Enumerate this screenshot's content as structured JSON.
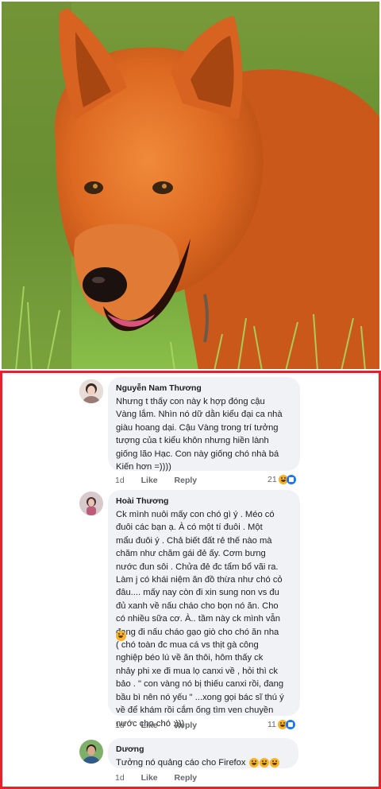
{
  "comments": [
    {
      "name": "Nguyễn Nam Thương",
      "text": "Nhưng t thấy con này k hợp đóng cậu\nVàng lắm. Nhìn nó dữ dằn kiểu đại ca nhà\ngiàu hoang dại. Cậu Vàng trong trí tưởng\ntượng của t kiểu khôn nhưng hiền lành\ngiống lão Hạc. Con này giống chó nhà bá\nKiến hơn =))))",
      "age": "1d",
      "like_label": "Like",
      "reply_label": "Reply",
      "react_count": "21"
    },
    {
      "name": "Hoài Thương",
      "text": "Ck mình nuôi mấy con chó gì ý . Méo có\nđuôi các bạn ạ. À có một tí đuôi . Một\nmẩu đuôi ý . Chả biết đất rẻ thế nào mà\nchăm như chăm gái đẻ ấy. Cơm bưng\nnước đun sôi . Chửa đẻ đc tẩm bổ vãi ra.\nLàm j có khái niệm ăn đồ thừa như chó cỏ\nđâu.... mấy nay còn đi xin sung non vs đu\nđủ xanh về nấu cháo cho bọn nó ăn. Cho\ncó nhiều sữa cơ. À.. tầm này ck mình vẫn\nđang đi nấu cháo gạo giò cho chó ăn nha\n   ( chó toàn đc mua cá vs thịt gà công\nnghiệp béo lú về ăn thôi, hôm thấy ck\nnhảy phi xe đi mua lọ canxi về , hỏi thì ck\nbảo . \" con vàng nó bị thiếu canxi rồi, đang\nbầu bì nên nó yếu \" ...xong gọi bác sĩ thú ý\nvề để khám rồi cắm ống tìm ven chuyền\nnước cho chó :)))",
      "age": "1d",
      "like_label": "Like",
      "reply_label": "Reply",
      "react_count": "11"
    },
    {
      "name": "Dương",
      "text": "Tưởng nó quảng cáo cho Firefox",
      "age": "1d",
      "like_label": "Like",
      "reply_label": "Reply",
      "react_count": ""
    }
  ],
  "colors": {
    "frame_border": "#e8202a",
    "bubble_bg": "#f0f2f5",
    "meta_text": "#65676b"
  },
  "icons": [
    "laugh-emoji-icon",
    "like-reaction-icon"
  ]
}
